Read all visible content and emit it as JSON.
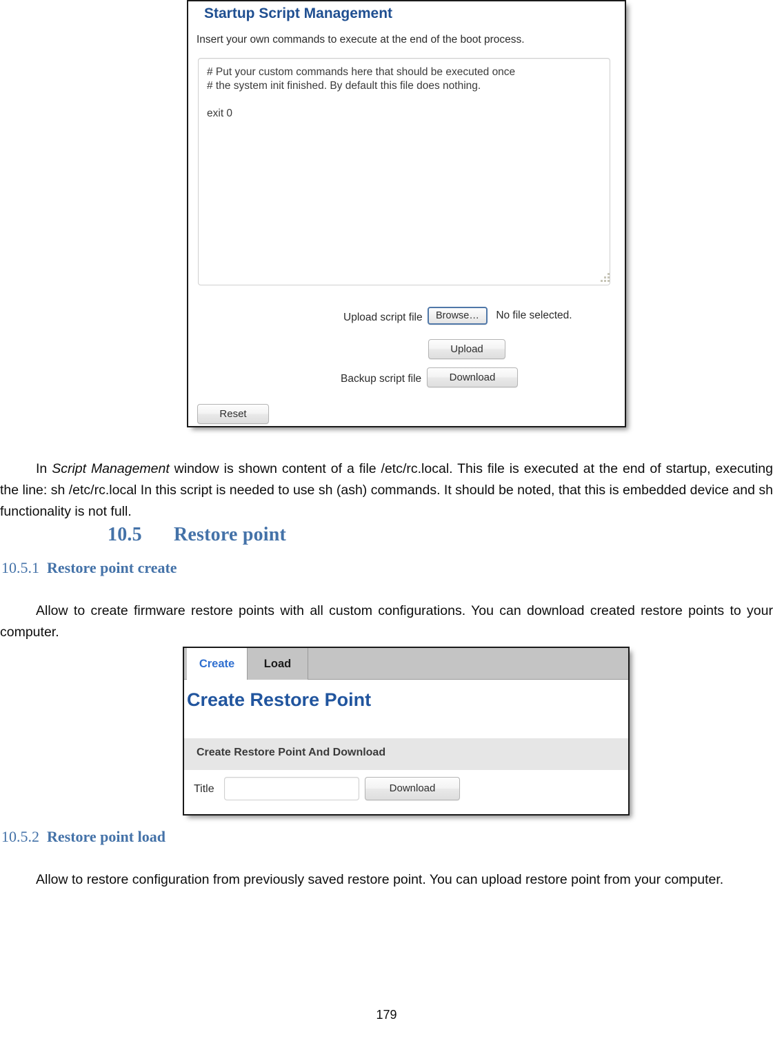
{
  "page": {
    "number": "179"
  },
  "screenshot_script": {
    "title": "Startup Script Management",
    "subtitle": "Insert your own commands to execute at the end of the boot process.",
    "script_content": "# Put your custom commands here that should be executed once\n# the system init finished. By default this file does nothing.\n\nexit 0",
    "upload_label": "Upload script file",
    "browse_button": "Browse…",
    "file_status": "No file selected.",
    "upload_button": "Upload",
    "backup_label": "Backup script file",
    "download_button": "Download",
    "reset_button": "Reset"
  },
  "body_text": {
    "paragraph_1": "In Script Management window is shown content of a file /etc/rc.local. This file is executed at the end of startup, executing the line: sh /etc/rc.local In this script is needed to use sh (ash) commands. It should be noted, that this is embedded device and sh functionality is not full.",
    "paragraph_1_lead": "In ",
    "paragraph_1_italic": "Script Management",
    "paragraph_1_rest": " window is shown content of a file /etc/rc.local. This file is executed at the end of startup, executing the line: sh /etc/rc.local In this script is needed to use sh (ash) commands. It should be noted, that this is embedded device and sh functionality is not full.",
    "paragraph_2": "Allow to create firmware restore points with all custom configurations. You can download created restore points to your computer.",
    "paragraph_3": "Allow to restore configuration from previously saved restore point. You can upload restore point from your computer."
  },
  "headings": {
    "section_10_5_number": "10.5",
    "section_10_5_title": "Restore point",
    "section_10_5_1_number": "10.5.1",
    "section_10_5_1_title": "Restore point create",
    "section_10_5_2_number": "10.5.2",
    "section_10_5_2_title": "Restore point load"
  },
  "screenshot_restore": {
    "tab_create": "Create",
    "tab_load": "Load",
    "title": "Create Restore Point",
    "section_bar": "Create Restore Point And Download",
    "title_label": "Title",
    "title_value": "",
    "title_placeholder": "",
    "download_button": "Download"
  },
  "colors": {
    "heading_blue": "#4472a8",
    "app_title_blue": "#1f4f91",
    "tab_active_blue": "#2f6fd0",
    "restore_title_blue": "#21559e",
    "tabstrip_grey": "#c4c4c4",
    "section_bar_grey": "#e6e6e6"
  }
}
